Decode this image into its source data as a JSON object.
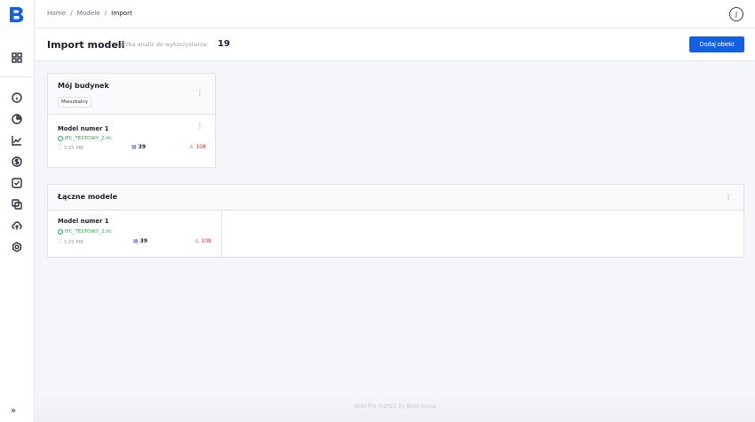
{
  "app": {
    "logo_letter": "B"
  },
  "breadcrumb": {
    "items": [
      "Home",
      "Modele",
      "Import"
    ],
    "separator": "/"
  },
  "user": {
    "avatar_initial": "J"
  },
  "header": {
    "title": "Import modeli",
    "usage_label": "Liczba analiz do wykorzystania:",
    "usage_count": "19",
    "add_button": "Dodaj obiekt"
  },
  "building": {
    "title": "Mój budynek",
    "tag": "Mieszkalny",
    "menu": "⋮",
    "model": {
      "name": "Model numer 1",
      "file": "IFC_TESTOWY_2.ifc",
      "size": "3.05 MB",
      "elements": "39",
      "warnings": "108",
      "menu": "⋮"
    }
  },
  "combined": {
    "title": "Łączne modele",
    "menu": "⋮",
    "model": {
      "name": "Model numer 1",
      "file": "IFC_TESTOWY_2.ifc",
      "size": "3.05 MB",
      "elements": "39",
      "warnings": "108"
    }
  },
  "sidebar": {
    "icons": [
      "dashboard-icon",
      "info-icon",
      "pie-chart-icon",
      "line-chart-icon",
      "dollar-icon",
      "checkbox-icon",
      "copy-icon",
      "cloud-upload-icon",
      "settings-icon"
    ],
    "expand": "»"
  },
  "footer": {
    "text": "Bold Pro ©2022 by Bold Group"
  },
  "colors": {
    "accent": "#1560e0",
    "success": "#2ea44f",
    "danger": "#e03131"
  }
}
